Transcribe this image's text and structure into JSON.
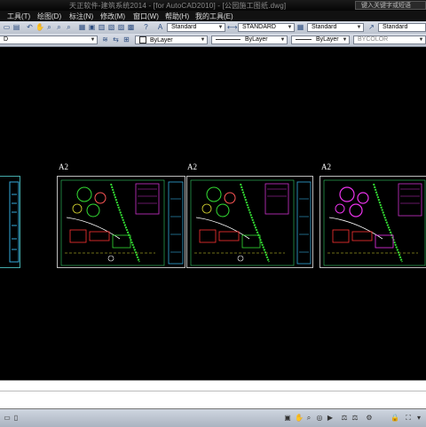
{
  "title_bar": {
    "title": "天正软件-建筑系统2014 - [for AutoCAD2010] - [公园施工图纸.dwg]",
    "search_placeholder": "键入关键字或短语"
  },
  "menu": [
    {
      "label": "工具(T)"
    },
    {
      "label": "绘图(D)"
    },
    {
      "label": "标注(N)"
    },
    {
      "label": "修改(M)"
    },
    {
      "label": "窗口(W)"
    },
    {
      "label": "帮助(H)"
    },
    {
      "label": "我的工具(E)"
    }
  ],
  "toolbar": {
    "text_style": "Standard",
    "dim_style": "STANDARD",
    "table_style": "Standard",
    "multileader_style": "Standard",
    "layer": "ByLayer",
    "linetype": "ByLayer",
    "lineweight": "ByLayer",
    "plot_style": "BYCOLOR",
    "workspace_fragment": "D"
  },
  "drawing": {
    "layout_labels": [
      "A2",
      "A2",
      "A2"
    ]
  },
  "command": {
    "history": "",
    "prompt": ""
  }
}
